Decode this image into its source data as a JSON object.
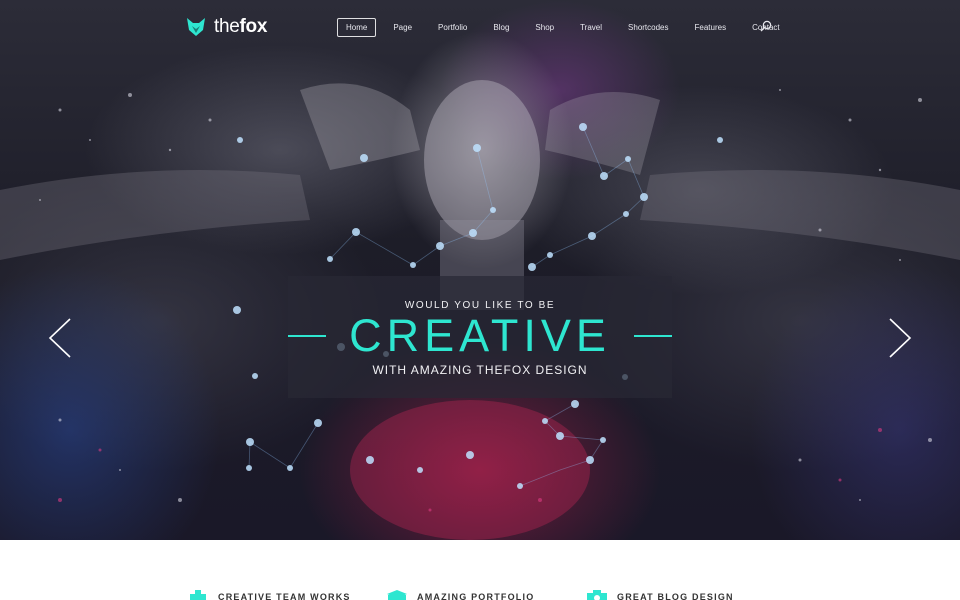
{
  "brand": {
    "logo_light": "the",
    "logo_bold": "fox",
    "accent_color": "#2ee6d0"
  },
  "nav": {
    "items": [
      {
        "label": "Home",
        "active": true
      },
      {
        "label": "Page"
      },
      {
        "label": "Portfolio"
      },
      {
        "label": "Blog"
      },
      {
        "label": "Shop"
      },
      {
        "label": "Travel"
      },
      {
        "label": "Shortcodes"
      },
      {
        "label": "Features"
      },
      {
        "label": "Contact"
      }
    ],
    "search_icon": "search-icon"
  },
  "slider": {
    "pretitle": "WOULD YOU LIKE TO BE",
    "title": "CREATIVE",
    "subtitle": "WITH AMAZING THEFOX DESIGN",
    "prev_icon": "chevron-left-icon",
    "next_icon": "chevron-right-icon"
  },
  "features": [
    {
      "title": "CREATIVE TEAM WORKS",
      "icon": "team-icon"
    },
    {
      "title": "AMAZING PORTFOLIO",
      "icon": "box-icon"
    },
    {
      "title": "GREAT BLOG DESIGN",
      "icon": "camera-icon"
    }
  ]
}
